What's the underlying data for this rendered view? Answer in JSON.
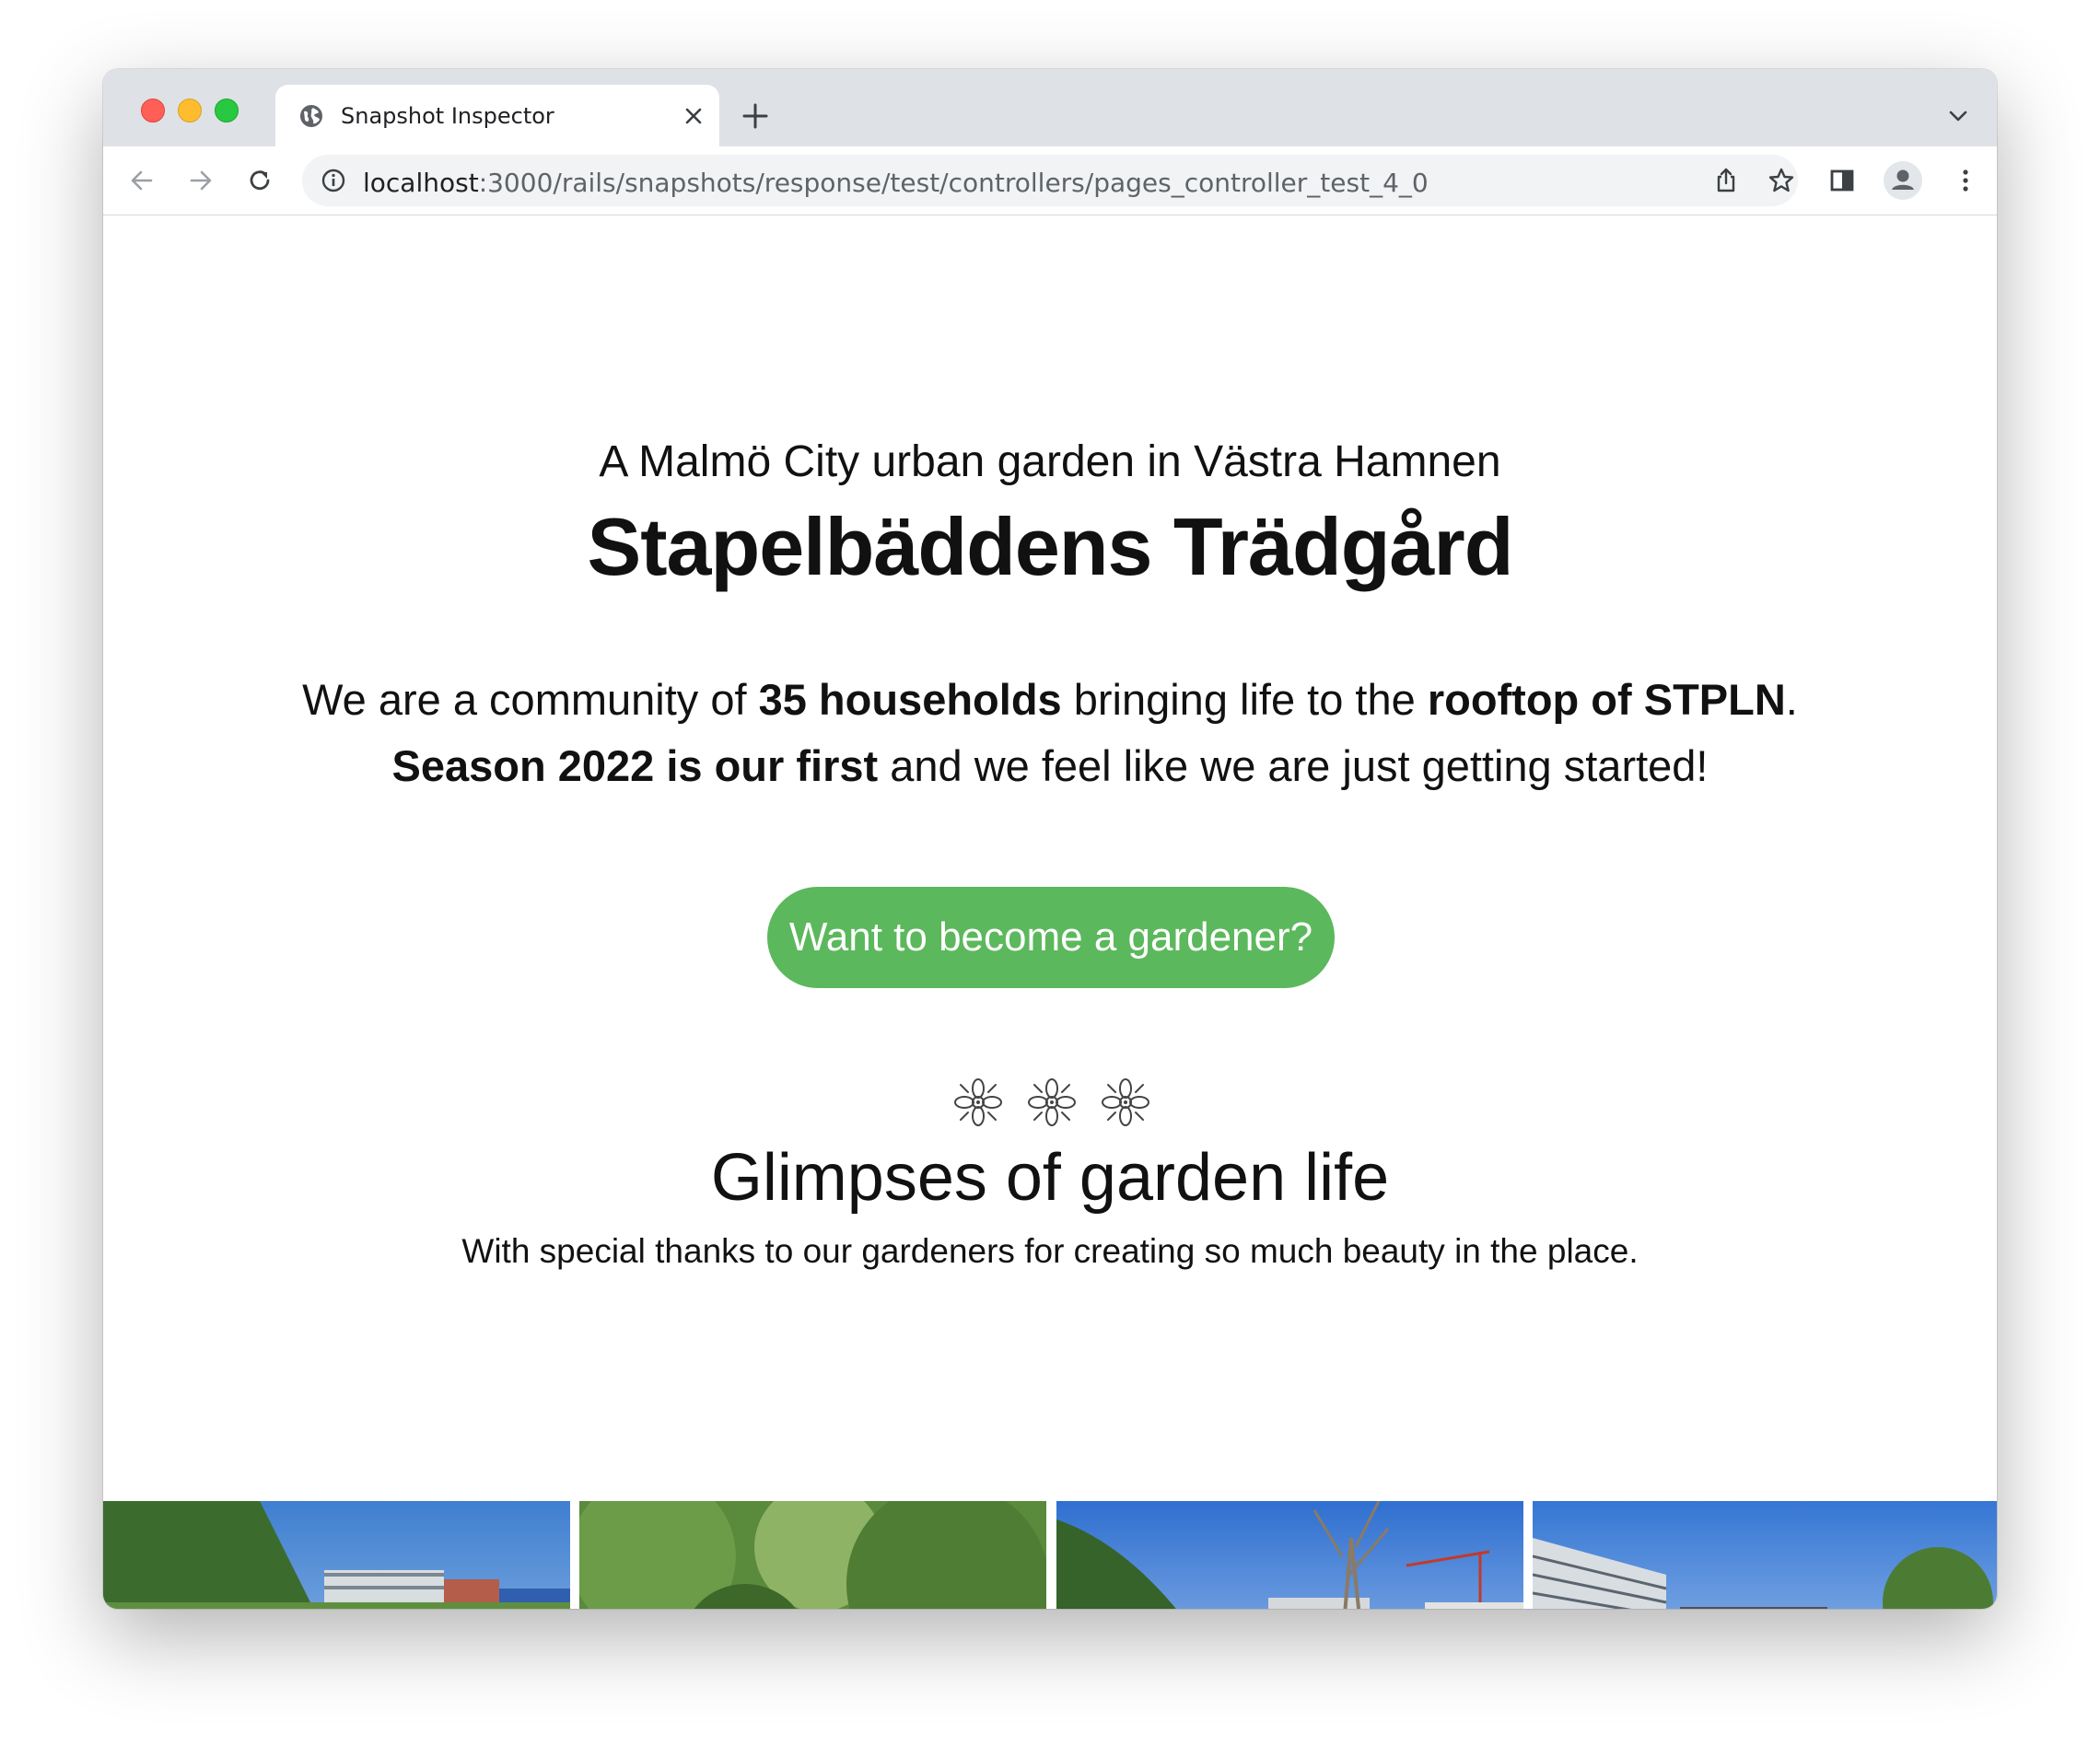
{
  "browser": {
    "tab_title": "Snapshot Inspector",
    "url_host": "localhost",
    "url_rest": ":3000/rails/snapshots/response/test/controllers/pages_controller_test_4_0"
  },
  "hero": {
    "subtitle": "A Malmö City urban garden in Västra Hamnen",
    "title": "Stapelbäddens Trädgård",
    "intro": {
      "part1": "We are a community of ",
      "bold1": "35 households",
      "part2": " bringing life to the ",
      "bold2": "rooftop of STPLN",
      "part3": ".",
      "bold3": "Season 2022 is our first",
      "part4": " and we feel like we are just getting started!"
    },
    "cta_label": "Want to become a gardener?"
  },
  "decoration": {
    "icon": "flower-ornament-icon",
    "count": 3
  },
  "gallery": {
    "heading": "Glimpses of garden life",
    "caption": "With special thanks to our gardeners for creating so much beauty in the place.",
    "photos": [
      "garden-photo-1",
      "garden-photo-2",
      "garden-photo-3",
      "garden-photo-4"
    ]
  },
  "colors": {
    "cta_green": "#5cb85c",
    "tabstrip": "#dee1e6",
    "omnibox": "#f1f3f4"
  }
}
